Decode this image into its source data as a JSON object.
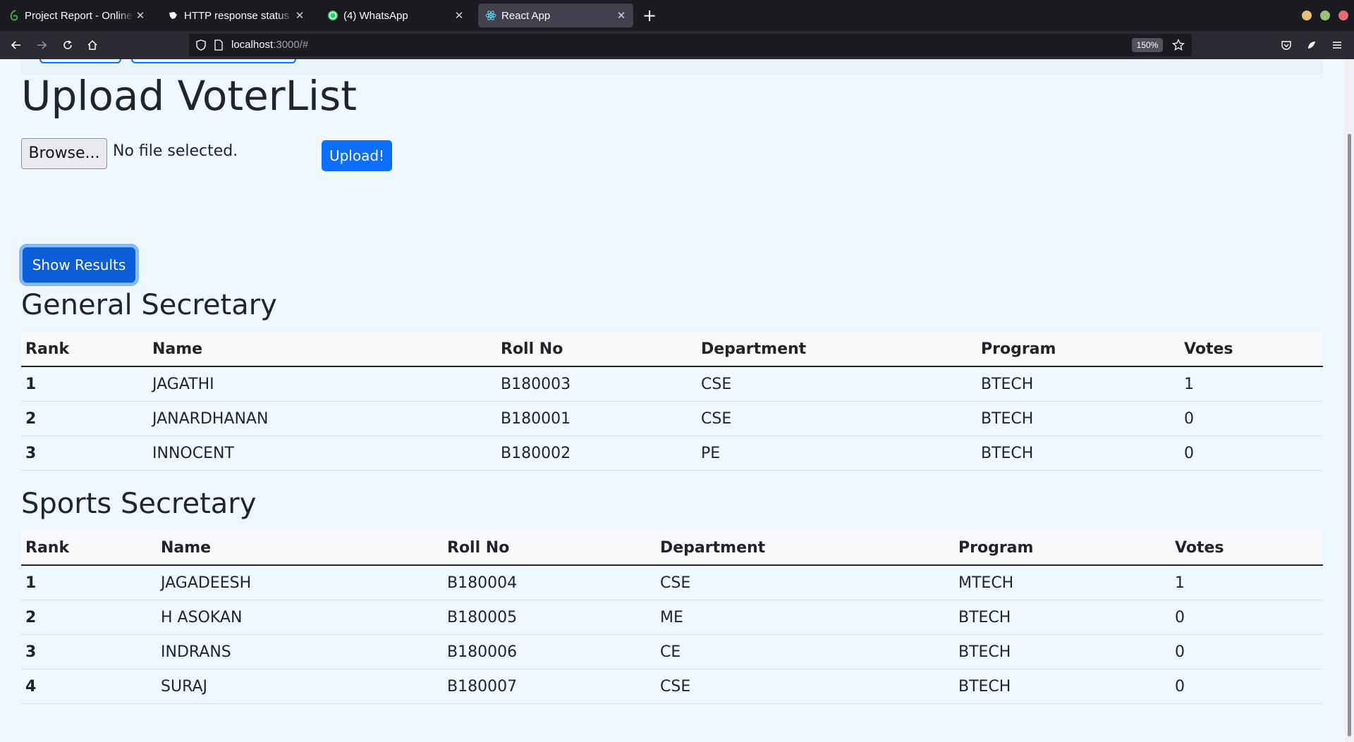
{
  "browser": {
    "tabs": [
      {
        "title": "Project Report - Online LaTeX Editor Overleaf",
        "favicon": "overleaf-icon",
        "color": "#46a247"
      },
      {
        "title": "HTTP response status codes - HTTP | MDN",
        "favicon": "mdn-icon",
        "color": "#ffffff"
      },
      {
        "title": "(4) WhatsApp",
        "favicon": "whatsapp-icon",
        "color": "#25d366"
      },
      {
        "title": "React App",
        "favicon": "react-icon",
        "color": "#61dafb",
        "active": true
      }
    ],
    "url_host": "localhost",
    "url_path": ":3000/#",
    "zoom": "150%",
    "window_dots": [
      "#e5c07b",
      "#98c379",
      "#e06c75"
    ]
  },
  "page": {
    "title": "Upload VoterList",
    "browse_label": "Browse...",
    "file_status": "No file selected.",
    "upload_label": "Upload!",
    "show_results_label": "Show Results"
  },
  "columns": [
    "Rank",
    "Name",
    "Roll No",
    "Department",
    "Program",
    "Votes"
  ],
  "sections": [
    {
      "title": "General Secretary",
      "rows": [
        [
          "1",
          "JAGATHI",
          "B180003",
          "CSE",
          "BTECH",
          "1"
        ],
        [
          "2",
          "JANARDHANAN",
          "B180001",
          "CSE",
          "BTECH",
          "0"
        ],
        [
          "3",
          "INNOCENT",
          "B180002",
          "PE",
          "BTECH",
          "0"
        ]
      ]
    },
    {
      "title": "Sports Secretary",
      "rows": [
        [
          "1",
          "JAGADEESH",
          "B180004",
          "CSE",
          "MTECH",
          "1"
        ],
        [
          "2",
          "H ASOKAN",
          "B180005",
          "ME",
          "BTECH",
          "0"
        ],
        [
          "3",
          "INDRANS",
          "B180006",
          "CE",
          "BTECH",
          "0"
        ],
        [
          "4",
          "SURAJ",
          "B180007",
          "CSE",
          "BTECH",
          "0"
        ]
      ]
    }
  ],
  "colors": {
    "primary": "#0d6efd",
    "page_bg": "#f0f8ff",
    "text": "#212529"
  }
}
